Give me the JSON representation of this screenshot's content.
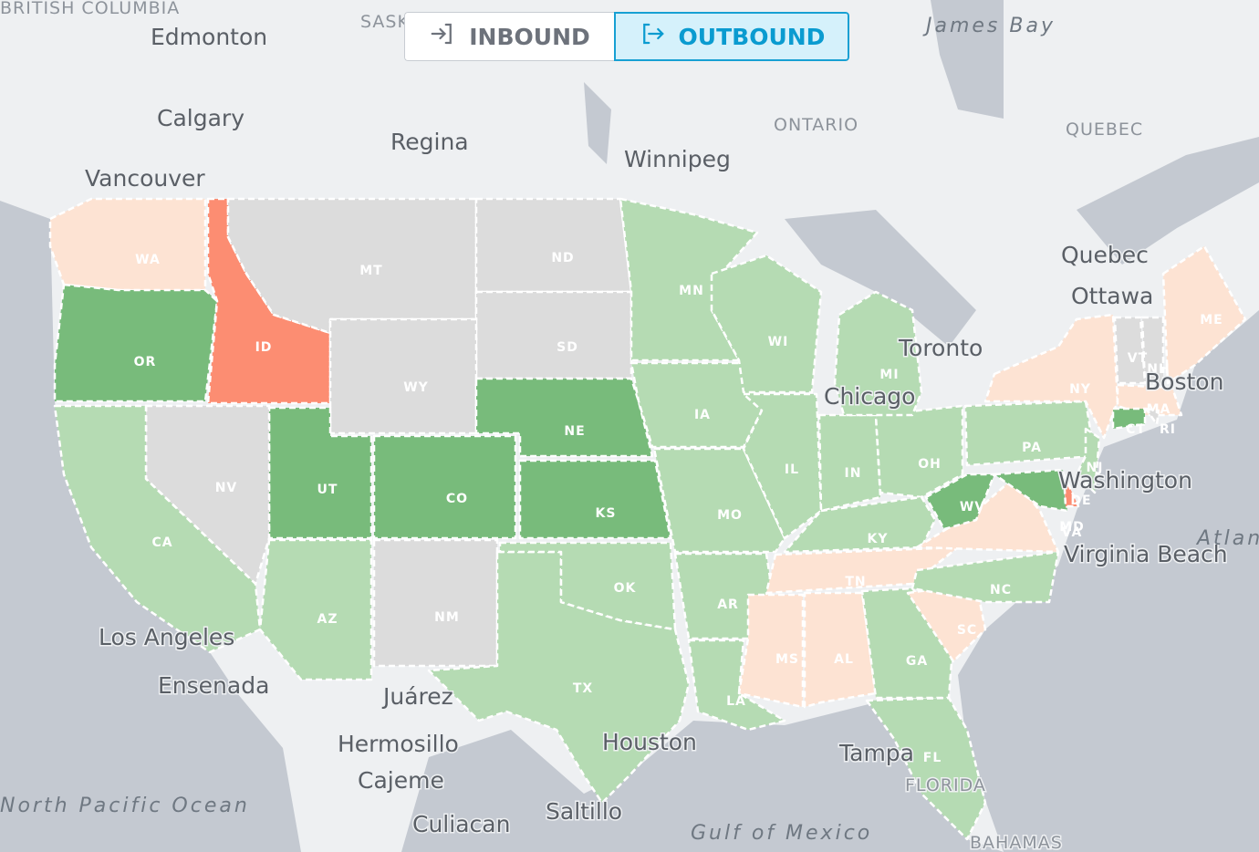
{
  "toggle": {
    "inbound_label": "INBOUND",
    "outbound_label": "OUTBOUND",
    "selected": "outbound",
    "inbound_icon": "arrow-into-bracket-icon",
    "outbound_icon": "arrow-out-of-bracket-icon"
  },
  "colors": {
    "dark_green": "#78bb7b",
    "light_green": "#b5dbb3",
    "peach": "#fde3d3",
    "red": "#fc8d72",
    "grey": "#dcdcdc",
    "water": "#c4c9d1",
    "land": "#eef0f2"
  },
  "states": [
    {
      "code": "WA",
      "level": "peach"
    },
    {
      "code": "OR",
      "level": "dark_green"
    },
    {
      "code": "ID",
      "level": "red"
    },
    {
      "code": "MT",
      "level": "grey"
    },
    {
      "code": "ND",
      "level": "grey"
    },
    {
      "code": "SD",
      "level": "grey"
    },
    {
      "code": "WY",
      "level": "grey"
    },
    {
      "code": "NE",
      "level": "dark_green"
    },
    {
      "code": "KS",
      "level": "dark_green"
    },
    {
      "code": "CO",
      "level": "dark_green"
    },
    {
      "code": "UT",
      "level": "dark_green"
    },
    {
      "code": "NV",
      "level": "grey"
    },
    {
      "code": "CA",
      "level": "light_green"
    },
    {
      "code": "AZ",
      "level": "light_green"
    },
    {
      "code": "NM",
      "level": "grey"
    },
    {
      "code": "TX",
      "level": "light_green"
    },
    {
      "code": "OK",
      "level": "light_green"
    },
    {
      "code": "MN",
      "level": "light_green"
    },
    {
      "code": "IA",
      "level": "light_green"
    },
    {
      "code": "MO",
      "level": "light_green"
    },
    {
      "code": "AR",
      "level": "light_green"
    },
    {
      "code": "LA",
      "level": "light_green"
    },
    {
      "code": "WI",
      "level": "light_green"
    },
    {
      "code": "IL",
      "level": "light_green"
    },
    {
      "code": "IN",
      "level": "light_green"
    },
    {
      "code": "OH",
      "level": "light_green"
    },
    {
      "code": "MI",
      "level": "light_green"
    },
    {
      "code": "KY",
      "level": "light_green"
    },
    {
      "code": "TN",
      "level": "peach"
    },
    {
      "code": "MS",
      "level": "peach"
    },
    {
      "code": "AL",
      "level": "peach"
    },
    {
      "code": "GA",
      "level": "light_green"
    },
    {
      "code": "FL",
      "level": "light_green"
    },
    {
      "code": "SC",
      "level": "peach"
    },
    {
      "code": "NC",
      "level": "light_green"
    },
    {
      "code": "VA",
      "level": "peach"
    },
    {
      "code": "WV",
      "level": "dark_green"
    },
    {
      "code": "PA",
      "level": "light_green"
    },
    {
      "code": "MD",
      "level": "dark_green"
    },
    {
      "code": "DE",
      "level": "red"
    },
    {
      "code": "NJ",
      "level": "light_green"
    },
    {
      "code": "NY",
      "level": "peach"
    },
    {
      "code": "VT",
      "level": "grey"
    },
    {
      "code": "NH",
      "level": "grey"
    },
    {
      "code": "ME",
      "level": "peach"
    },
    {
      "code": "MA",
      "level": "peach"
    },
    {
      "code": "CT",
      "level": "dark_green"
    },
    {
      "code": "RI",
      "level": "grey"
    }
  ],
  "places": {
    "british_columbia": "BRITISH COLUMBIA",
    "edmonton": "Edmonton",
    "calgary": "Calgary",
    "vancouver": "Vancouver",
    "regina": "Regina",
    "sask": "SASK",
    "winnipeg": "Winnipeg",
    "ontario": "ONTARIO",
    "james_bay": "James Bay",
    "quebec_region": "QUEBEC",
    "quebec": "Quebec",
    "ottawa": "Ottawa",
    "toronto": "Toronto",
    "chicago": "Chicago",
    "boston": "Boston",
    "washington": "Washington",
    "virginia_beach": "Virginia Beach",
    "atlantic": "Atlantic",
    "los_angeles": "Los Angeles",
    "ensenada": "Ensenada",
    "juarez": "Juárez",
    "hermosillo": "Hermosillo",
    "cajeme": "Cajeme",
    "culiacan": "Culiacan",
    "saltillo": "Saltillo",
    "houston": "Houston",
    "tampa": "Tampa",
    "florida": "FLORIDA",
    "gulf": "Gulf of Mexico",
    "bahamas": "BAHAMAS",
    "north_pacific": "North Pacific Ocean"
  }
}
